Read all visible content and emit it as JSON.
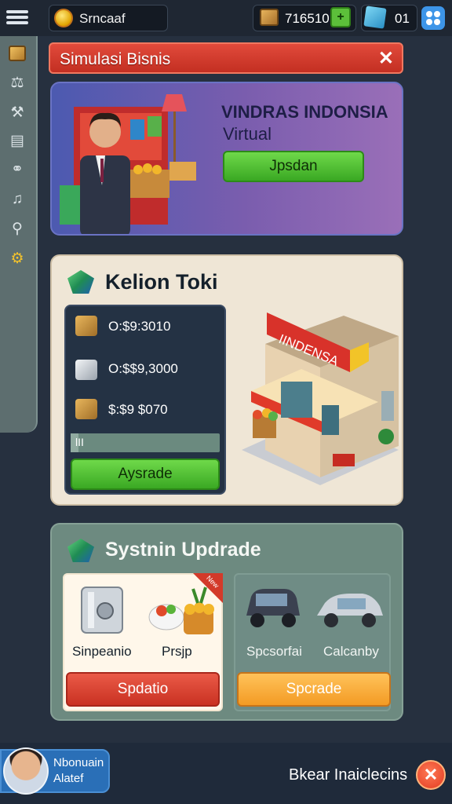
{
  "topbar": {
    "player_name": "Srncaaf",
    "resource_1": "716510",
    "resource_1_icon": "crate-icon",
    "resource_2": "01",
    "resource_2_icon": "cube-icon"
  },
  "sidebar": {
    "icons": [
      "crate-icon",
      "coins-icon",
      "hammer-icon",
      "storage-icon",
      "link-icon",
      "audio-icon",
      "search-icon",
      "gear-icon"
    ]
  },
  "dialog": {
    "title": "Simulasi Bisnis"
  },
  "hero": {
    "company": "VINDRAS INDONSIA",
    "subtitle": "Virtual",
    "button": "Jpsdan"
  },
  "shop": {
    "title": "Kelion Toki",
    "sign": "IINDENSA",
    "stats": [
      {
        "icon": "crate-icon",
        "value": "O:$9:3010"
      },
      {
        "icon": "gear-box-icon",
        "value": "O:$$9,3000"
      },
      {
        "icon": "crate-icon",
        "value": "$:$9 $070"
      }
    ],
    "progress": {
      "tick": "lII",
      "fraction": 0.05
    },
    "upgrade_button": "Aysrade"
  },
  "system": {
    "title": "Systnin Updrade",
    "left_items": [
      "Sinpeanio",
      "Prsjp"
    ],
    "left_ribbon": "New",
    "left_button": "Spdatio",
    "right_items": [
      "Spcsorfai",
      "Calcanby"
    ],
    "right_button": "Spcrade"
  },
  "bottombar": {
    "profile_line1": "Nbonuain",
    "profile_line2": "Alatef",
    "message": "Bkear Inaiclecins"
  },
  "colors": {
    "background": "#26303f",
    "banner_red": "#d43a2b",
    "button_green": "#4cbf2f",
    "button_orange": "#f5a532"
  }
}
